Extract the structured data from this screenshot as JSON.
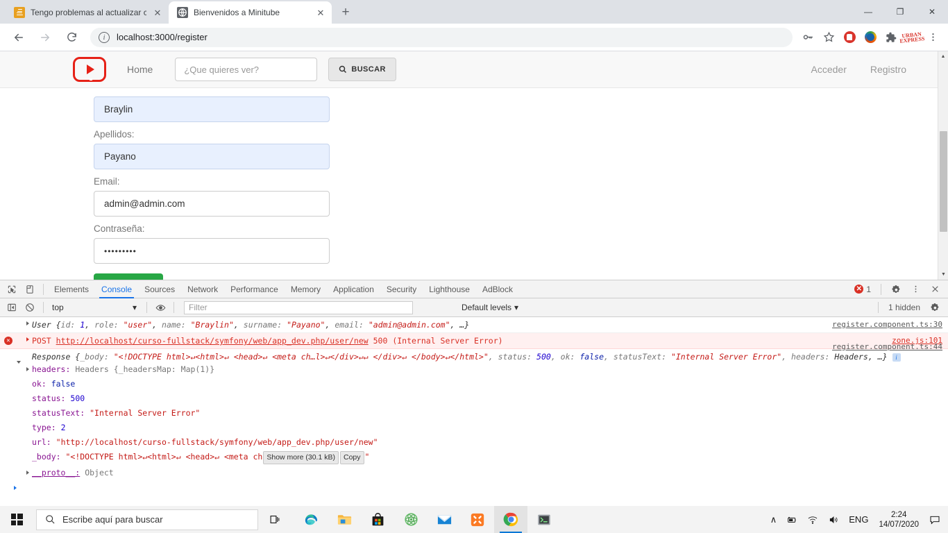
{
  "browser": {
    "tabs": [
      {
        "title": "Tengo problemas al actualizar co",
        "favicon": "stackoverflow-icon",
        "active": false
      },
      {
        "title": "Bienvenidos a Minitube",
        "favicon": "globe-icon",
        "active": true
      }
    ],
    "new_tab_label": "+",
    "window_controls": {
      "minimize": "—",
      "maximize": "❐",
      "close": "✕"
    },
    "omnibox": {
      "url": "localhost:3000/register",
      "security_icon": "info-icon"
    },
    "toolbar_icons": [
      "key-icon",
      "star-icon",
      "adblock-icon",
      "download-manager-icon",
      "puzzle-extensions-icon",
      "urban-express-icon",
      "kebab-menu-icon"
    ],
    "nav": {
      "back": "←",
      "forward": "→",
      "reload": "↻"
    }
  },
  "site": {
    "logo": "minitube-logo-icon",
    "nav_home": "Home",
    "search_placeholder": "¿Que quieres ver?",
    "search_button": "BUSCAR",
    "nav_right": [
      "Acceder",
      "Registro"
    ]
  },
  "form": {
    "fields": [
      {
        "label": "",
        "value": "Braylin",
        "autofill": true,
        "name": "nombre-input"
      },
      {
        "label": "Apellidos:",
        "value": "Payano",
        "autofill": true,
        "name": "apellidos-input"
      },
      {
        "label": "Email:",
        "value": "admin@admin.com",
        "autofill": false,
        "name": "email-input"
      },
      {
        "label": "Contraseña:",
        "value": "•••••••••",
        "autofill": false,
        "name": "password-input"
      }
    ],
    "submit_label": ""
  },
  "devtools": {
    "tabs": [
      "Elements",
      "Console",
      "Sources",
      "Network",
      "Performance",
      "Memory",
      "Application",
      "Security",
      "Lighthouse",
      "AdBlock"
    ],
    "active_tab": "Console",
    "error_count": "1",
    "filterbar": {
      "context": "top",
      "filter_placeholder": "Filter",
      "levels": "Default levels",
      "hidden": "1 hidden"
    },
    "console": {
      "row1": {
        "prefix": "User {",
        "k_id": "id:",
        "v_id": "1",
        "k_role": "role:",
        "v_role": "\"user\"",
        "k_name": "name:",
        "v_name": "\"Braylin\"",
        "k_surname": "surname:",
        "v_surname": "\"Payano\"",
        "k_email": "email:",
        "v_email": "\"admin@admin.com\"",
        "ellipsis": ", …}",
        "source": "register.component.ts:30"
      },
      "row2": {
        "method": "POST",
        "url": "http://localhost/curso-fullstack/symfony/web/app_dev.php/user/new",
        "status": "500 (Internal Server Error)",
        "source": "zone.js:101"
      },
      "row3": {
        "source": "register.component.ts:44",
        "label": "Response {",
        "body_key": "_body:",
        "body_val": "\"<!DOCTYPE html>↵<html>↵      <head>↵           <meta ch…l>↵</div>↵↵          </div>↵   </body>↵</html>\"",
        "k_status": ", status:",
        "v_status": "500",
        "k_ok": ", ok:",
        "v_ok": "false",
        "k_statusText": ", statusText:",
        "v_statusText": "\"Internal Server Error\"",
        "k_headers": ", headers:",
        "v_headers": "Headers, …}",
        "badge": "i",
        "props": [
          {
            "key": "headers:",
            "value": "Headers {_headersMap: Map(1)}",
            "expandable": true,
            "type": "obj"
          },
          {
            "key": "ok:",
            "value": "false",
            "expandable": false,
            "type": "bool"
          },
          {
            "key": "status:",
            "value": "500",
            "expandable": false,
            "type": "num"
          },
          {
            "key": "statusText:",
            "value": "\"Internal Server Error\"",
            "expandable": false,
            "type": "str"
          },
          {
            "key": "type:",
            "value": "2",
            "expandable": false,
            "type": "num"
          },
          {
            "key": "url:",
            "value": "\"http://localhost/curso-fullstack/symfony/web/app_dev.php/user/new\"",
            "expandable": false,
            "type": "str"
          }
        ],
        "body_row": {
          "key": "_body:",
          "value_start": "\"<!DOCTYPE html>↵<html>↵    <head>↵          <meta ch",
          "show_more": "Show more (30.1 kB)",
          "copy": "Copy",
          "value_end": "\""
        },
        "proto": {
          "key": "__proto__:",
          "value": "Object"
        }
      }
    }
  },
  "taskbar": {
    "search_placeholder": "Escribe aquí para buscar",
    "apps": [
      "edge-icon",
      "file-explorer-icon",
      "microsoft-store-icon",
      "atom-icon",
      "mail-icon",
      "xampp-icon",
      "chrome-icon",
      "terminal-icon"
    ],
    "active_app": "chrome-icon",
    "tray": {
      "chevron": "∧",
      "battery": "battery-icon",
      "wifi": "wifi-icon",
      "volume": "volume-icon",
      "language": "ENG"
    },
    "clock": {
      "time": "2:24",
      "date": "14/07/2020"
    },
    "notifications": "notification-icon"
  }
}
